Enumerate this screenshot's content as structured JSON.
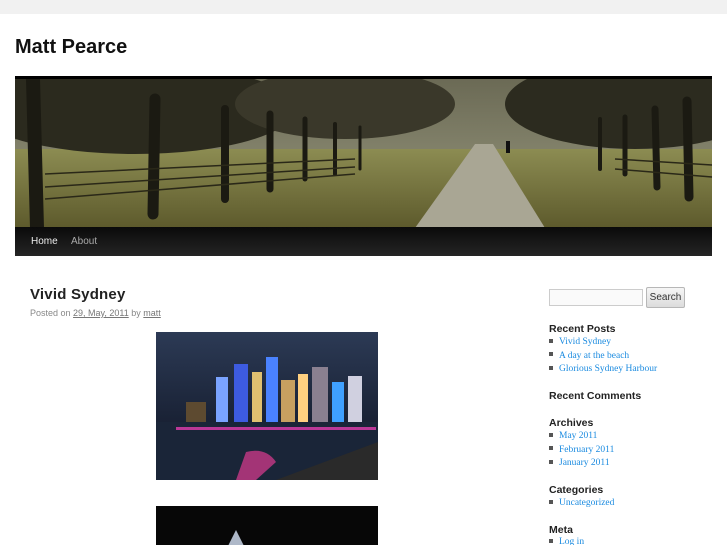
{
  "site": {
    "title": "Matt Pearce"
  },
  "nav": {
    "home": "Home",
    "about": "About"
  },
  "post": {
    "title": "Vivid Sydney",
    "posted_on": "Posted on",
    "date": "29, May, 2011",
    "by": "by",
    "author": "matt"
  },
  "search": {
    "placeholder": "",
    "value": "",
    "button": "Search"
  },
  "widgets": {
    "recent_posts": {
      "title": "Recent Posts",
      "items": [
        "Vivid Sydney",
        "A day at the beach",
        "Glorious Sydney Harbour"
      ]
    },
    "recent_comments": {
      "title": "Recent Comments"
    },
    "archives": {
      "title": "Archives",
      "items": [
        "May 2011",
        "February 2011",
        "January 2011"
      ]
    },
    "categories": {
      "title": "Categories",
      "items": [
        "Uncategorized"
      ]
    },
    "meta": {
      "title": "Meta",
      "items": [
        "Log in"
      ]
    }
  },
  "colors": {
    "link": "#1b8be0",
    "nav_bar": "#0a0a0a",
    "page_bg": "#ffffff",
    "outer_bg": "#f1f1f1"
  }
}
